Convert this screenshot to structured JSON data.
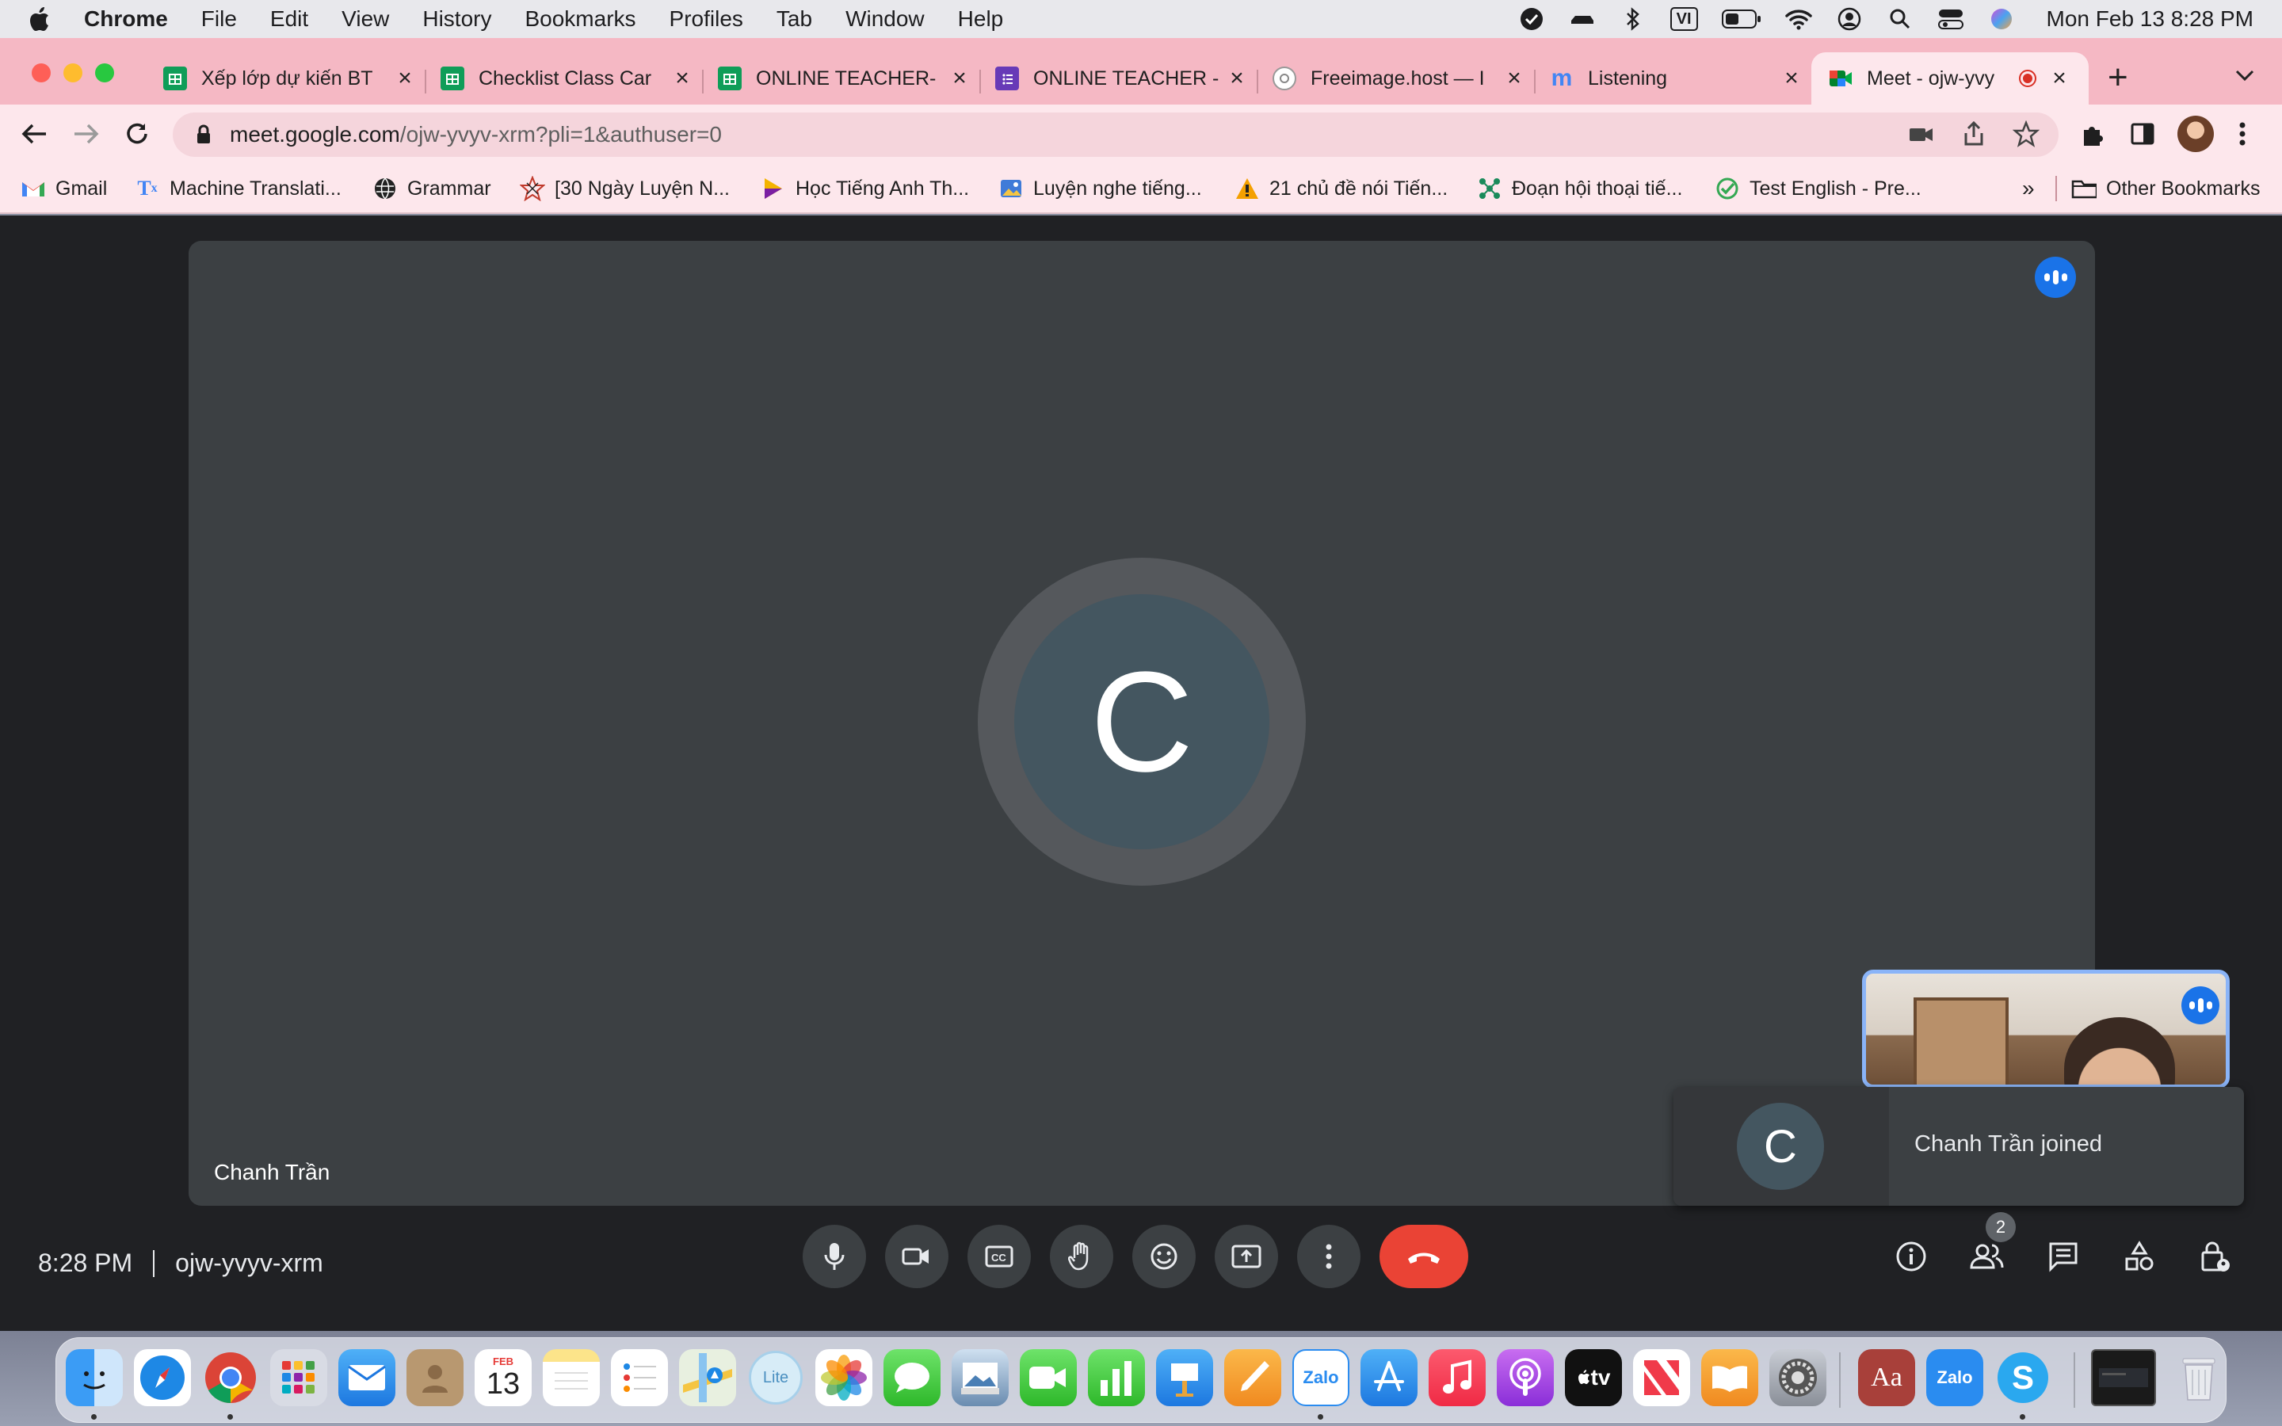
{
  "menubar": {
    "app_name": "Chrome",
    "items": [
      "File",
      "Edit",
      "View",
      "History",
      "Bookmarks",
      "Profiles",
      "Tab",
      "Window",
      "Help"
    ],
    "input_source": "VI",
    "clock": "Mon Feb 13  8:28 PM"
  },
  "tabs": [
    {
      "title": "Xếp lớp dự kiến BT",
      "icon": "sheets-icon"
    },
    {
      "title": "Checklist Class Car",
      "icon": "sheets-icon"
    },
    {
      "title": "ONLINE TEACHER-",
      "icon": "sheets-icon"
    },
    {
      "title": "ONLINE TEACHER -",
      "icon": "forms-icon"
    },
    {
      "title": "Freeimage.host — I",
      "icon": "freeimage-icon"
    },
    {
      "title": "Listening",
      "icon": "m-icon"
    },
    {
      "title": "Meet - ojw-yvy",
      "icon": "meet-icon",
      "active": true
    }
  ],
  "omnibox": {
    "host": "meet.google.com",
    "path": "/ojw-yvyv-xrm?pli=1&authuser=0"
  },
  "bookmarks": {
    "items": [
      {
        "label": "Gmail",
        "icon": "gmail-icon"
      },
      {
        "label": "Machine Translati...",
        "icon": "translate-icon"
      },
      {
        "label": "Grammar",
        "icon": "globe-icon"
      },
      {
        "label": "[30 Ngày Luyện N...",
        "icon": "star-icon"
      },
      {
        "label": "Học Tiếng Anh Th...",
        "icon": "play-icon"
      },
      {
        "label": "Luyện nghe tiếng...",
        "icon": "image-icon"
      },
      {
        "label": "21 chủ đề nói Tiến...",
        "icon": "warning-icon"
      },
      {
        "label": "Đoạn hội thoại tiế...",
        "icon": "network-icon"
      },
      {
        "label": "Test English - Pre...",
        "icon": "check-icon"
      }
    ],
    "overflow": "»",
    "other": "Other Bookmarks"
  },
  "meet": {
    "main_participant": {
      "initial": "C",
      "name": "Chanh Trần"
    },
    "toast": {
      "initial": "C",
      "message": "Chanh Trần joined"
    },
    "time": "8:28 PM",
    "meeting_code": "ojw-yvyv-xrm",
    "participant_count": "2",
    "colors": {
      "end_call": "#ea4335",
      "speaking": "#1a73e8",
      "tile_border": "#8ab4f8"
    }
  },
  "dock": {
    "calendar_month": "FEB",
    "calendar_day": "13",
    "maps_lite": "Lite",
    "zalo": "Zalo",
    "appletv": "tv",
    "dictionary": "Aa",
    "skype": "S"
  }
}
